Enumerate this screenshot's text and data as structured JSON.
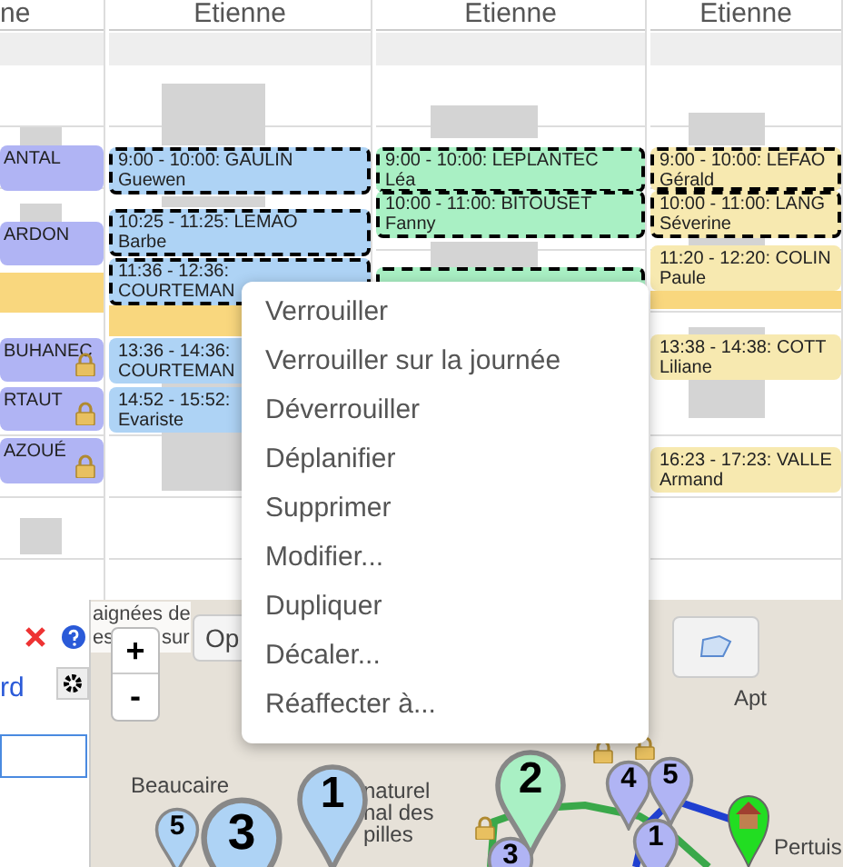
{
  "columns": [
    {
      "header": "ne",
      "events": [
        {
          "kind": "appointment",
          "title": "ANTAL",
          "color": "#b0b4f4",
          "selected": false,
          "locked": false
        },
        {
          "kind": "appointment",
          "title": "ARDON",
          "color": "#b0b4f4",
          "selected": false,
          "locked": false
        },
        {
          "kind": "bar",
          "color": "#f9d77e"
        },
        {
          "kind": "appointment",
          "title": "BUHANEC",
          "color": "#b0b4f4",
          "selected": false,
          "locked": true
        },
        {
          "kind": "appointment",
          "title": "RTAUT",
          "color": "#b0b4f4",
          "selected": false,
          "locked": true
        },
        {
          "kind": "appointment",
          "title": "AZOUÉ",
          "color": "#b0b4f4",
          "selected": false,
          "locked": true
        }
      ]
    },
    {
      "header": "Etienne",
      "events": [
        {
          "kind": "appointment",
          "title": "9:00 - 10:00: GAULIN",
          "subtitle": "Guewen",
          "color": "#aed3f5",
          "selected": true,
          "locked": false
        },
        {
          "kind": "appointment",
          "title": "10:25 - 11:25: LEMAO",
          "subtitle": "Barbe",
          "color": "#aed3f5",
          "selected": true,
          "locked": false
        },
        {
          "kind": "appointment",
          "title": "11:36 - 12:36:",
          "subtitle": "COURTEMAN",
          "color": "#aed3f5",
          "selected": true,
          "locked": false
        },
        {
          "kind": "bar",
          "color": "#f9d77e"
        },
        {
          "kind": "appointment",
          "title": "13:36 - 14:36:",
          "subtitle": "COURTEMAN",
          "color": "#aed3f5",
          "selected": false,
          "locked": false
        },
        {
          "kind": "appointment",
          "title": "14:52 - 15:52:",
          "subtitle": "Evariste",
          "color": "#aed3f5",
          "selected": false,
          "locked": false
        }
      ]
    },
    {
      "header": "Etienne",
      "events": [
        {
          "kind": "appointment",
          "title": "9:00 - 10:00: LEPLANTEC",
          "subtitle": "Léa",
          "color": "#a9f0c4",
          "selected": true,
          "locked": false
        },
        {
          "kind": "appointment",
          "title": "10:00 - 11:00: BITOUSET",
          "subtitle": "Fanny",
          "color": "#a9f0c4",
          "selected": true,
          "locked": false
        },
        {
          "kind": "appointment",
          "color": "#a9f0c4",
          "selected": true,
          "locked": false
        }
      ]
    },
    {
      "header": "Etienne",
      "events": [
        {
          "kind": "appointment",
          "title": "9:00 - 10:00: LEFAO",
          "subtitle": "Gérald",
          "color": "#f7e9b0",
          "selected": true,
          "locked": false
        },
        {
          "kind": "appointment",
          "title": "10:00 - 11:00: LANG",
          "subtitle": "Séverine",
          "color": "#f7e9b0",
          "selected": true,
          "locked": false
        },
        {
          "kind": "appointment",
          "title": "11:20 - 12:20: COLIN",
          "subtitle": "Paule",
          "color": "#f7e9b0",
          "selected": false,
          "locked": false
        },
        {
          "kind": "bar",
          "color": "#f9d77e"
        },
        {
          "kind": "appointment",
          "title": "13:38 - 14:38: COTT",
          "subtitle": "Liliane",
          "color": "#f7e9b0",
          "selected": false,
          "locked": false
        },
        {
          "kind": "appointment",
          "title": "16:23 - 17:23: VALLE",
          "subtitle": "Armand",
          "color": "#f7e9b0",
          "selected": false,
          "locked": false
        }
      ]
    }
  ],
  "context_menu": {
    "items": [
      {
        "label": "Verrouiller"
      },
      {
        "label": "Verrouiller sur la journée"
      },
      {
        "label": "Déverrouiller"
      },
      {
        "label": "Déplanifier"
      },
      {
        "label": "Supprimer"
      },
      {
        "label": "Modifier..."
      },
      {
        "label": "Dupliquer"
      },
      {
        "label": "Décaler..."
      },
      {
        "label": "Réaffecter à..."
      }
    ]
  },
  "side_panel": {
    "tab_label": "rd"
  },
  "map": {
    "banner_line_1": "aignées de",
    "banner_line_2_parts": [
      "es",
      "sur"
    ],
    "options_button": "Op",
    "zoom_in": "+",
    "zoom_out": "-",
    "labels": [
      "Beaucaire",
      "naturel",
      "nal des",
      "pilles",
      "Apt",
      "Pertuis"
    ],
    "markers": [
      {
        "number": "5",
        "color": "#aed3f5",
        "locked": false
      },
      {
        "number": "3",
        "color": "#aed3f5",
        "locked": false
      },
      {
        "number": "1",
        "color": "#aed3f5",
        "locked": false
      },
      {
        "number": "2",
        "color": "#a9f0c4",
        "locked": false
      },
      {
        "number": "3",
        "color": "#b0b4f4",
        "locked": true
      },
      {
        "number": "4",
        "color": "#b0b4f4",
        "locked": true
      },
      {
        "number": "5",
        "color": "#b0b4f4",
        "locked": true
      },
      {
        "number": "1",
        "color": "#b0b4f4",
        "locked": false
      }
    ]
  }
}
